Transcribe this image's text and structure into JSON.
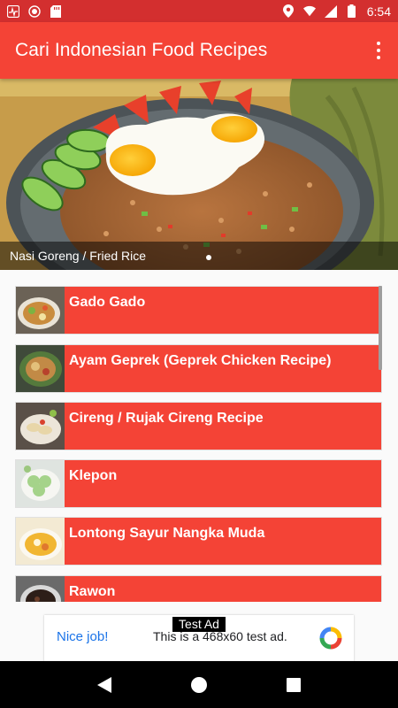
{
  "status_bar": {
    "time": "6:54",
    "icons": [
      "activity-icon",
      "record-icon",
      "sd-card-icon",
      "location-icon",
      "wifi-icon",
      "signal-icon",
      "battery-icon"
    ]
  },
  "app_bar": {
    "title": "Cari Indonesian Food Recipes",
    "menu_icon": "more-vert-icon"
  },
  "colors": {
    "app_bar": "#f44336",
    "status_bar": "#d32f2f",
    "item_background": "#f44336",
    "item_text": "#ffffff"
  },
  "hero": {
    "caption": "Nasi Goreng / Fried Rice",
    "active_slide": 1,
    "slide_count": 1
  },
  "recipes": [
    {
      "label": "Gado Gado"
    },
    {
      "label": "Ayam Geprek (Geprek Chicken Recipe)"
    },
    {
      "label": "Cireng / Rujak Cireng Recipe"
    },
    {
      "label": "Klepon"
    },
    {
      "label": "Lontong Sayur Nangka Muda"
    },
    {
      "label": "Rawon"
    }
  ],
  "ad": {
    "tag": "Test Ad",
    "nice": "Nice job!",
    "text": "This is a 468x60 test ad."
  },
  "nav_bar": {
    "buttons": [
      "back-icon",
      "home-icon",
      "recents-icon"
    ]
  }
}
